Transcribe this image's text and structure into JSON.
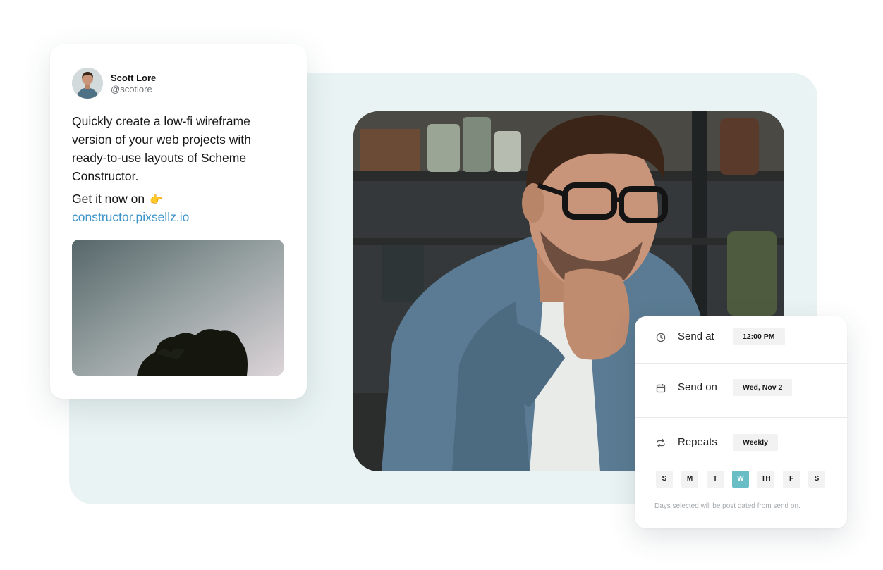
{
  "tweet": {
    "author_name": "Scott Lore",
    "author_handle": "@scotlore",
    "text": "Quickly create a low-fi wireframe version of your web projects with ready-to-use layouts of Scheme Constructor.",
    "cta_text": "Get it now on",
    "cta_emoji": "👉",
    "link_text": "constructor.pixsellz.io"
  },
  "schedule": {
    "rows": [
      {
        "icon": "clock-icon",
        "label": "Send at",
        "value": "12:00 PM"
      },
      {
        "icon": "calendar-icon",
        "label": "Send on",
        "value": "Wed, Nov 2"
      },
      {
        "icon": "repeat-icon",
        "label": "Repeats",
        "value": "Weekly"
      }
    ],
    "days": [
      {
        "label": "S",
        "selected": false
      },
      {
        "label": "M",
        "selected": false
      },
      {
        "label": "T",
        "selected": false
      },
      {
        "label": "W",
        "selected": true
      },
      {
        "label": "TH",
        "selected": false
      },
      {
        "label": "F",
        "selected": false
      },
      {
        "label": "S",
        "selected": false
      }
    ],
    "note": "Days selected will be post dated from send on."
  },
  "colors": {
    "panel_bg": "#e9f3f3",
    "link": "#3b93c8",
    "day_selected": "#69bec6",
    "chip_bg": "#f2f2f2"
  }
}
